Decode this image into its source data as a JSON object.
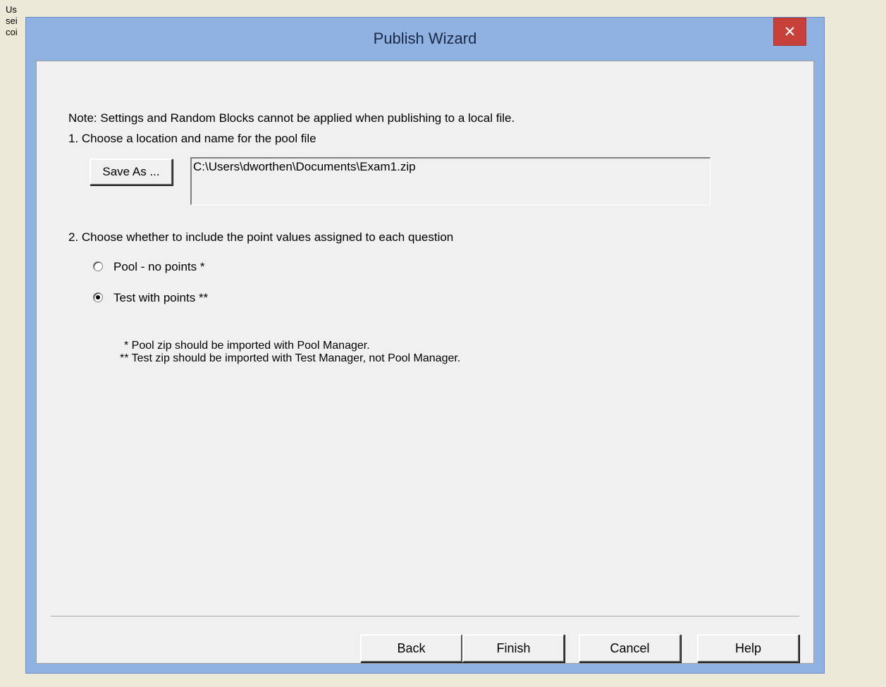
{
  "background": {
    "lines": [
      "Us",
      "sei",
      "coi"
    ]
  },
  "window": {
    "title": "Publish Wizard",
    "close_glyph": "✕"
  },
  "content": {
    "note": "Note: Settings and Random Blocks cannot be applied when publishing to a local file.",
    "step1_label": "1.  Choose a location and name for the pool file",
    "save_as_label": "Save As ...",
    "file_path": "C:\\Users\\dworthen\\Documents\\Exam1.zip",
    "step2_label": "2.  Choose whether to include the point values assigned to each question",
    "options": [
      {
        "label": "Pool - no points *",
        "selected": false
      },
      {
        "label": "Test with points **",
        "selected": true
      }
    ],
    "footnote1": "* Pool zip should be imported with Pool Manager.",
    "footnote2": "** Test zip should be imported with Test Manager, not Pool Manager."
  },
  "buttons": {
    "back": "Back",
    "finish": "Finish",
    "cancel": "Cancel",
    "help": "Help"
  },
  "colors": {
    "frame": "#8fb2e3",
    "close": "#c7403a",
    "client": "#f0f0f0",
    "desktop": "#ece9d8"
  }
}
